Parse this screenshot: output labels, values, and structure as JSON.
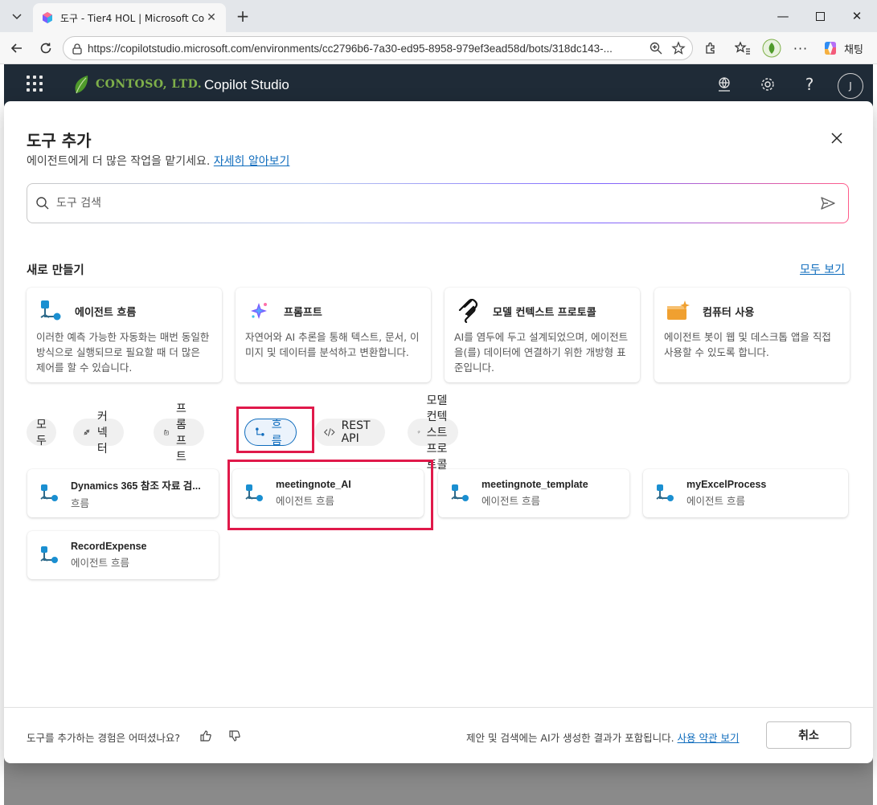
{
  "browser": {
    "tab_title": "도구 - Tier4 HOL | Microsoft Copilot",
    "url": "https://copilotstudio.microsoft.com/environments/cc2796b6-7a30-ed95-8958-979ef3ead58d/bots/318dc143-...",
    "chat_label": "채팅"
  },
  "app": {
    "brand": "CONTOSO, LTD.",
    "product": "Copilot Studio",
    "avatar_initial": "J"
  },
  "dialog": {
    "title": "도구 추가",
    "subtitle": "에이전트에게 더 많은 작업을 맡기세요.",
    "learn_more": "자세히 알아보기",
    "search_placeholder": "도구 검색",
    "create_section": "새로 만들기",
    "see_all": "모두 보기",
    "create_cards": [
      {
        "icon": "agent-flow-icon",
        "title": "에이전트 흐름",
        "desc": "이러한 예측 가능한 자동화는 매번 동일한 방식으로 실행되므로 필요할 때 더 많은 제어를 할 수 있습니다."
      },
      {
        "icon": "prompt-sparkle-icon",
        "title": "프롬프트",
        "desc": "자연어와 AI 추론을 통해 텍스트, 문서, 이미지 및 데이터를 분석하고 변환합니다."
      },
      {
        "icon": "mcp-icon",
        "title": "모델 컨텍스트 프로토콜",
        "desc": "AI를 염두에 두고 설계되었으며, 에이전트을(를) 데이터에 연결하기 위한 개방형 표준입니다."
      },
      {
        "icon": "computer-use-icon",
        "title": "컴퓨터 사용",
        "desc": "에이전트 봇이 웹 및 데스크톱 앱을 직접 사용할 수 있도록 합니다."
      }
    ],
    "filters": [
      {
        "label": "모두",
        "icon": ""
      },
      {
        "label": "커넥터",
        "icon": "connector-icon"
      },
      {
        "label": "프롬프트",
        "icon": "prompt-icon"
      },
      {
        "label": "흐름",
        "icon": "flow-icon",
        "active": true
      },
      {
        "label": "REST API",
        "icon": "code-icon"
      },
      {
        "label": "모델 컨텍스트 프로토콜",
        "icon": "mcp-icon"
      }
    ],
    "tools": [
      {
        "name": "Dynamics 365 참조 자료 검...",
        "type": "흐름"
      },
      {
        "name": "meetingnote_AI",
        "type": "에이전트 흐름"
      },
      {
        "name": "meetingnote_template",
        "type": "에이전트 흐름"
      },
      {
        "name": "myExcelProcess",
        "type": "에이전트 흐름"
      },
      {
        "name": "RecordExpense",
        "type": "에이전트 흐름"
      }
    ],
    "feedback_text": "도구를 추가하는 경험은 어떠셨나요?",
    "disclaimer": "제안 및 검색에는 AI가 생성한 결과가 포함됩니다.",
    "terms_link": "사용 약관 보기",
    "cancel": "취소"
  },
  "colors": {
    "accent": "#0f6cbd",
    "highlight": "#e0194a",
    "header_bg": "#1f2b37",
    "flow_blue": "#1a8fd1",
    "flow_teal": "#2f6a8a"
  }
}
